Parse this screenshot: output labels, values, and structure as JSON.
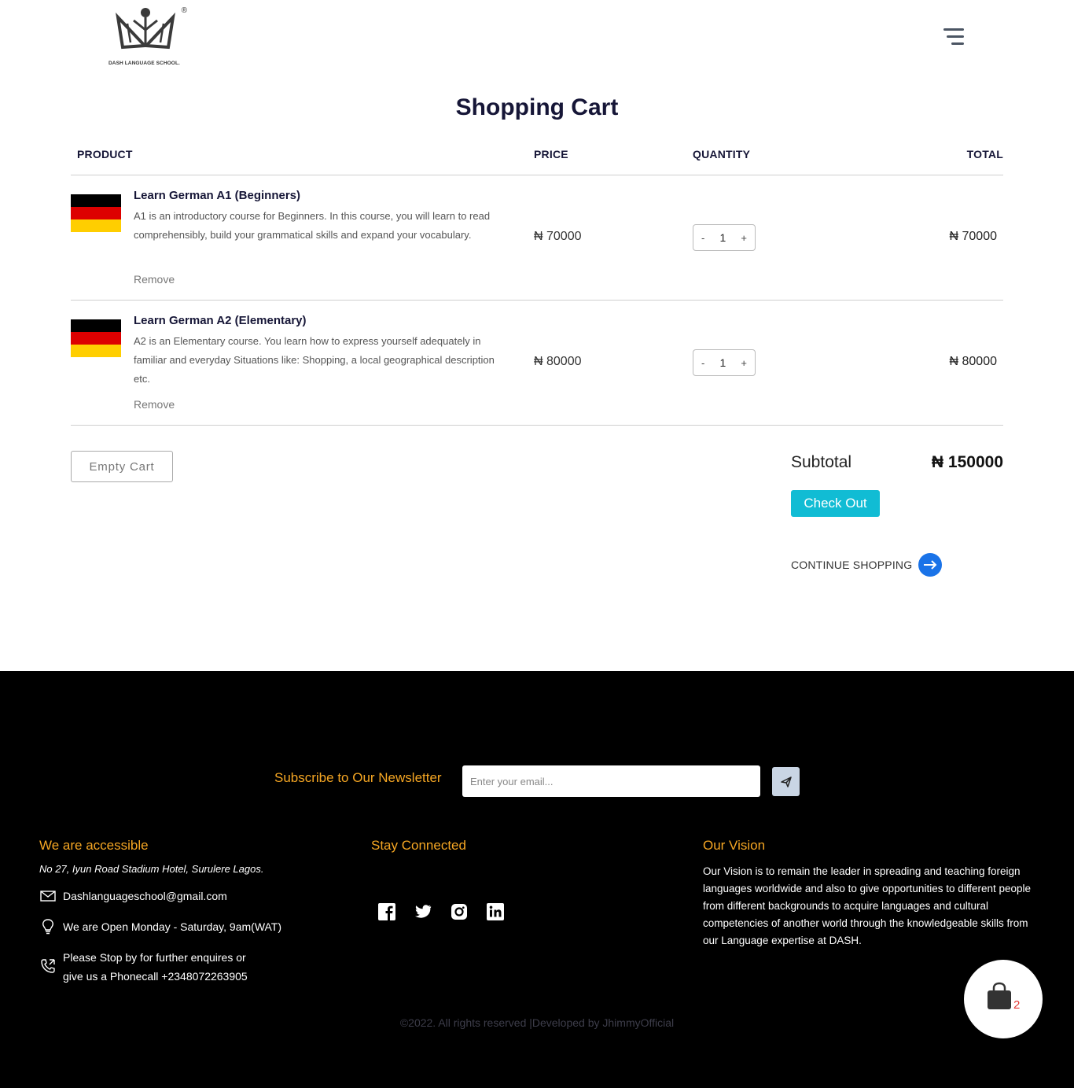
{
  "header": {
    "logo_text": "DASH LANGUAGE SCHOOL.",
    "logo_mark": "®"
  },
  "page_title": "Shopping Cart",
  "table": {
    "headers": {
      "product": "PRODUCT",
      "price": "PRICE",
      "quantity": "QUANTITY",
      "total": "TOTAL"
    }
  },
  "items": [
    {
      "name": "Learn German A1 (Beginners)",
      "description": "A1 is an introductory course for Beginners. In this course, you will learn to read comprehensibly, build your grammatical skills and expand your vocabulary.",
      "remove_label": "Remove",
      "price": "₦ 70000",
      "quantity": "1",
      "minus": "-",
      "plus": "+",
      "total": "₦ 70000",
      "flag_colors": [
        "#000000",
        "#dd0000",
        "#ffce00"
      ]
    },
    {
      "name": "Learn German A2 (Elementary)",
      "description": "A2 is an Elementary course. You learn how to express yourself adequately in familiar and everyday Situations like: Shopping, a local geographical description etc.",
      "remove_label": "Remove",
      "price": "₦ 80000",
      "quantity": "1",
      "minus": "-",
      "plus": "+",
      "total": "₦ 80000",
      "flag_colors": [
        "#000000",
        "#dd0000",
        "#ffce00"
      ]
    }
  ],
  "cart_actions": {
    "empty_cart_label": "Empty Cart",
    "subtotal_label": "Subtotal",
    "subtotal_value": "₦ 150000",
    "checkout_label": "Check Out",
    "continue_label": "CONTINUE SHOPPING"
  },
  "footer": {
    "newsletter_label": "Subscribe to Our Newsletter",
    "newsletter_placeholder": "Enter your email...",
    "accessible_heading": "We are accessible",
    "address": "No 27, Iyun Road Stadium Hotel, Surulere Lagos.",
    "email": "Dashlanguageschool@gmail.com",
    "hours": "We are Open Monday - Saturday, 9am(WAT)",
    "phone_line1": "Please Stop by for further enquires or",
    "phone_line2": "give us a Phonecall +2348072263905",
    "connected_heading": "Stay Connected",
    "vision_heading": "Our Vision",
    "vision_text": "Our Vision is to remain the leader in spreading and teaching foreign languages worldwide and also to give opportunities to different people from different backgrounds to acquire languages and cultural competencies of another world through the knowledgeable skills from our Language expertise at DASH.",
    "copyright": "©2022. All rights reserved |Developed by JhimmyOfficial"
  },
  "cart_badge": {
    "count": "2"
  },
  "colors": {
    "accent_orange": "#f5a623",
    "checkout_cyan": "#11bcd4",
    "continue_blue": "#1a73e8",
    "title_navy": "#161637"
  },
  "icons": [
    "hamburger-menu-icon",
    "arrow-right-icon",
    "send-icon",
    "mail-icon",
    "lightbulb-icon",
    "phone-icon",
    "facebook-icon",
    "twitter-icon",
    "instagram-icon",
    "linkedin-icon",
    "shopping-bag-icon"
  ]
}
